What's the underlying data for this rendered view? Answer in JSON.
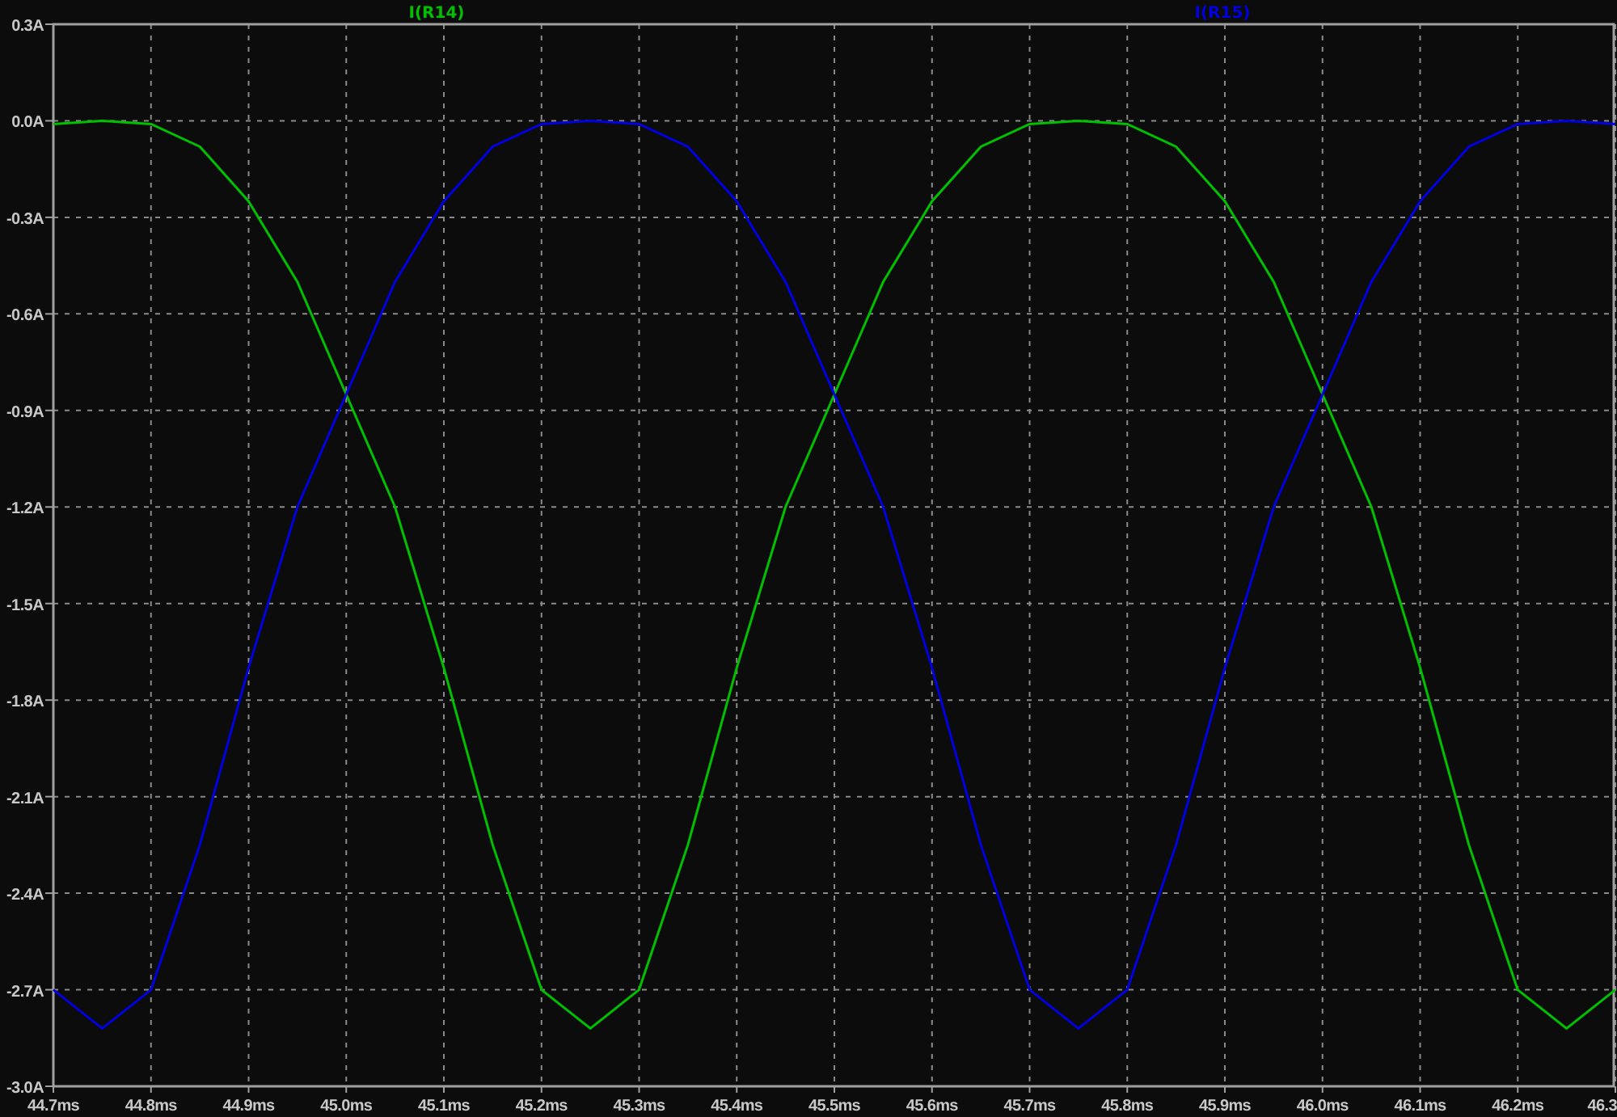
{
  "chart_data": {
    "type": "line",
    "x": [
      44.7,
      44.75,
      44.8,
      44.85,
      44.9,
      44.95,
      45.0,
      45.05,
      45.1,
      45.15,
      45.2,
      45.25,
      45.3,
      45.35,
      45.4,
      45.45,
      45.5,
      45.55,
      45.6,
      45.65,
      45.7,
      45.75,
      45.8,
      45.85,
      45.9,
      45.95,
      46.0,
      46.05,
      46.1,
      46.15,
      46.2,
      46.25,
      46.3
    ],
    "series": [
      {
        "name": "I(R14)",
        "color": "#00c000",
        "values": [
          -0.01,
          0,
          -0.01,
          -0.08,
          -0.25,
          -0.5,
          -0.85,
          -1.2,
          -1.7,
          -2.25,
          -2.7,
          -2.82,
          -2.7,
          -2.25,
          -1.7,
          -1.2,
          -0.85,
          -0.5,
          -0.25,
          -0.08,
          -0.01,
          0,
          -0.01,
          -0.08,
          -0.25,
          -0.5,
          -0.85,
          -1.2,
          -1.7,
          -2.25,
          -2.7,
          -2.82,
          -2.7
        ]
      },
      {
        "name": "I(R15)",
        "color": "#0000e0",
        "values": [
          -2.7,
          -2.82,
          -2.7,
          -2.25,
          -1.7,
          -1.2,
          -0.85,
          -0.5,
          -0.25,
          -0.08,
          -0.01,
          0,
          -0.01,
          -0.08,
          -0.25,
          -0.5,
          -0.85,
          -1.2,
          -1.7,
          -2.25,
          -2.7,
          -2.82,
          -2.7,
          -2.25,
          -1.7,
          -1.2,
          -0.85,
          -0.5,
          -0.25,
          -0.08,
          -0.01,
          0,
          -0.01
        ]
      }
    ],
    "xlim": [
      44.7,
      46.3
    ],
    "ylim": [
      -3.0,
      0.3
    ],
    "xticks": [
      {
        "value": 44.7,
        "label": "44.7ms"
      },
      {
        "value": 44.8,
        "label": "44.8ms"
      },
      {
        "value": 44.9,
        "label": "44.9ms"
      },
      {
        "value": 45.0,
        "label": "45.0ms"
      },
      {
        "value": 45.1,
        "label": "45.1ms"
      },
      {
        "value": 45.2,
        "label": "45.2ms"
      },
      {
        "value": 45.3,
        "label": "45.3ms"
      },
      {
        "value": 45.4,
        "label": "45.4ms"
      },
      {
        "value": 45.5,
        "label": "45.5ms"
      },
      {
        "value": 45.6,
        "label": "45.6ms"
      },
      {
        "value": 45.7,
        "label": "45.7ms"
      },
      {
        "value": 45.8,
        "label": "45.8ms"
      },
      {
        "value": 45.9,
        "label": "45.9ms"
      },
      {
        "value": 46.0,
        "label": "46.0ms"
      },
      {
        "value": 46.1,
        "label": "46.1ms"
      },
      {
        "value": 46.2,
        "label": "46.2ms"
      },
      {
        "value": 46.3,
        "label": "46.3"
      }
    ],
    "yticks": [
      {
        "value": 0.3,
        "label": "0.3A"
      },
      {
        "value": 0.0,
        "label": "0.0A"
      },
      {
        "value": -0.3,
        "label": "-0.3A"
      },
      {
        "value": -0.6,
        "label": "-0.6A"
      },
      {
        "value": -0.9,
        "label": "-0.9A"
      },
      {
        "value": -1.2,
        "label": "-1.2A"
      },
      {
        "value": -1.5,
        "label": "-1.5A"
      },
      {
        "value": -1.8,
        "label": "-1.8A"
      },
      {
        "value": -2.1,
        "label": "-2.1A"
      },
      {
        "value": -2.4,
        "label": "-2.4A"
      },
      {
        "value": -2.7,
        "label": "-2.7A"
      },
      {
        "value": -3.0,
        "label": "-3.0A"
      }
    ],
    "grid": true
  }
}
